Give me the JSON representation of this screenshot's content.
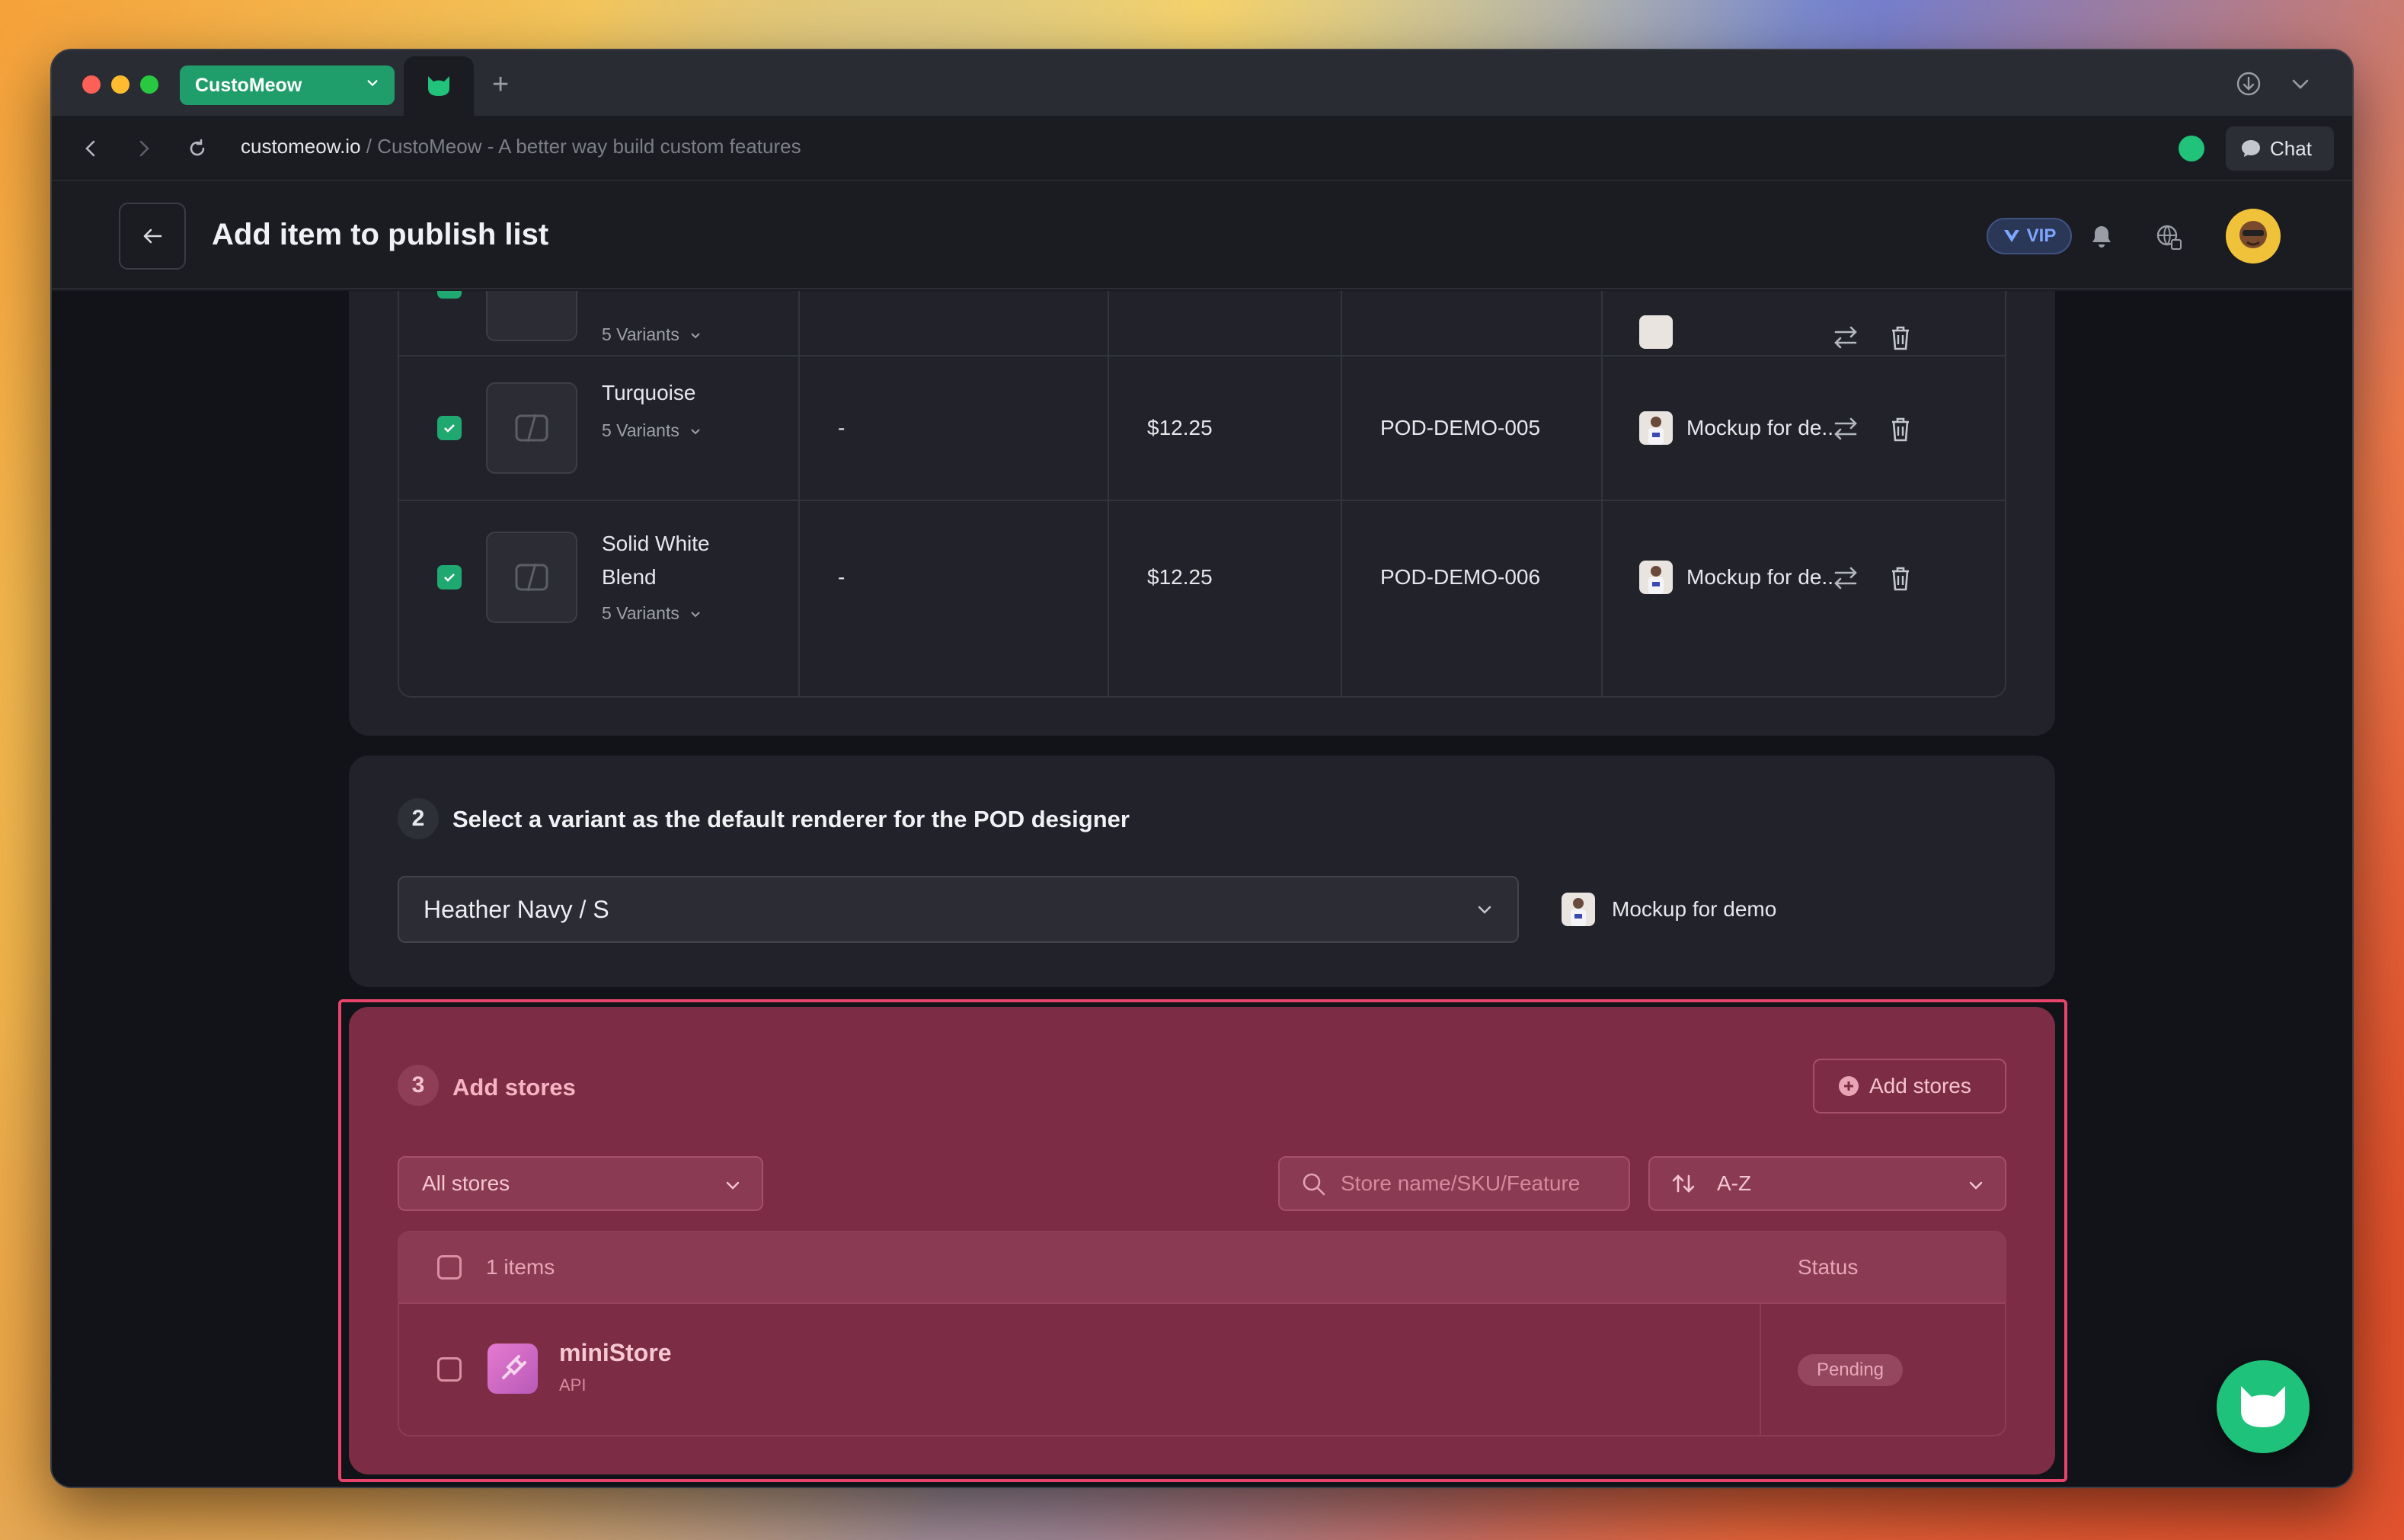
{
  "browser": {
    "workspace_name": "CustoMeow",
    "url_domain": "customeow.io",
    "url_title": " / CustoMeow - A better way build custom features",
    "chat_label": "Chat"
  },
  "header": {
    "title": "Add item to publish list",
    "vip_label": "VIP"
  },
  "variants_table": {
    "partial_row": {
      "variants_label": "5 Variants"
    },
    "rows": [
      {
        "name": "Turquoise",
        "variants_label": "5 Variants",
        "col2": "-",
        "price": "$12.25",
        "sku": "POD-DEMO-005",
        "mockup": "Mockup for de..."
      },
      {
        "name": "Solid White Blend",
        "variants_label": "5 Variants",
        "col2": "-",
        "price": "$12.25",
        "sku": "POD-DEMO-006",
        "mockup": "Mockup for de..."
      }
    ]
  },
  "step2": {
    "number": "2",
    "title": "Select a variant as the default renderer for the POD designer",
    "selected_variant": "Heather Navy / S",
    "mockup_label": "Mockup for demo"
  },
  "step3": {
    "number": "3",
    "title": "Add stores",
    "add_button": "Add stores",
    "filter_value": "All stores",
    "search_placeholder": "Store name/SKU/Feature",
    "sort_value": "A-Z",
    "table": {
      "count_label": "1 items",
      "status_header": "Status",
      "rows": [
        {
          "name": "miniStore",
          "type": "API",
          "status": "Pending"
        }
      ]
    }
  },
  "colors": {
    "accent_green": "#1fa870",
    "highlight_red": "#e8436a",
    "section_bg": "#7c2d45"
  }
}
